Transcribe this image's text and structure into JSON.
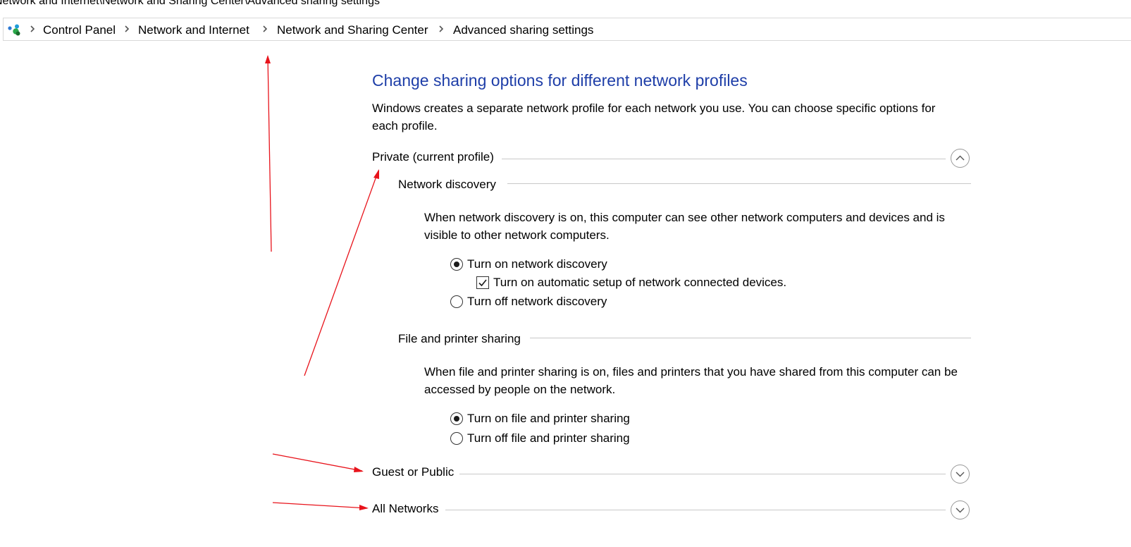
{
  "window": {
    "title_path": "Network and Internet\\Network and Sharing Center\\Advanced sharing settings"
  },
  "address_bar": {
    "icon": "network-globe-icon",
    "crumbs": [
      "Control Panel",
      "Network and Internet",
      "Network and Sharing Center",
      "Advanced sharing settings"
    ]
  },
  "main": {
    "heading": "Change sharing options for different network profiles",
    "intro": "Windows creates a separate network profile for each network you use. You can choose specific options for each profile.",
    "profiles": {
      "private": {
        "label": "Private (current profile)",
        "expanded": true,
        "network_discovery": {
          "label": "Network discovery",
          "description": "When network discovery is on, this computer can see other network computers and devices and is visible to other network computers.",
          "option_on": "Turn on network discovery",
          "option_auto_setup": "Turn on automatic setup of network connected devices.",
          "option_off": "Turn off network discovery",
          "selected": "on",
          "auto_setup_checked": true
        },
        "file_printer_sharing": {
          "label": "File and printer sharing",
          "description": "When file and printer sharing is on, files and printers that you have shared from this computer can be accessed by people on the network.",
          "option_on": "Turn on file and printer sharing",
          "option_off": "Turn off file and printer sharing",
          "selected": "on"
        }
      },
      "guest_public": {
        "label": "Guest or Public",
        "expanded": false
      },
      "all_networks": {
        "label": "All Networks",
        "expanded": false
      }
    }
  },
  "colors": {
    "heading": "#1e3ea8",
    "annotation_arrows": "#e8131b"
  }
}
